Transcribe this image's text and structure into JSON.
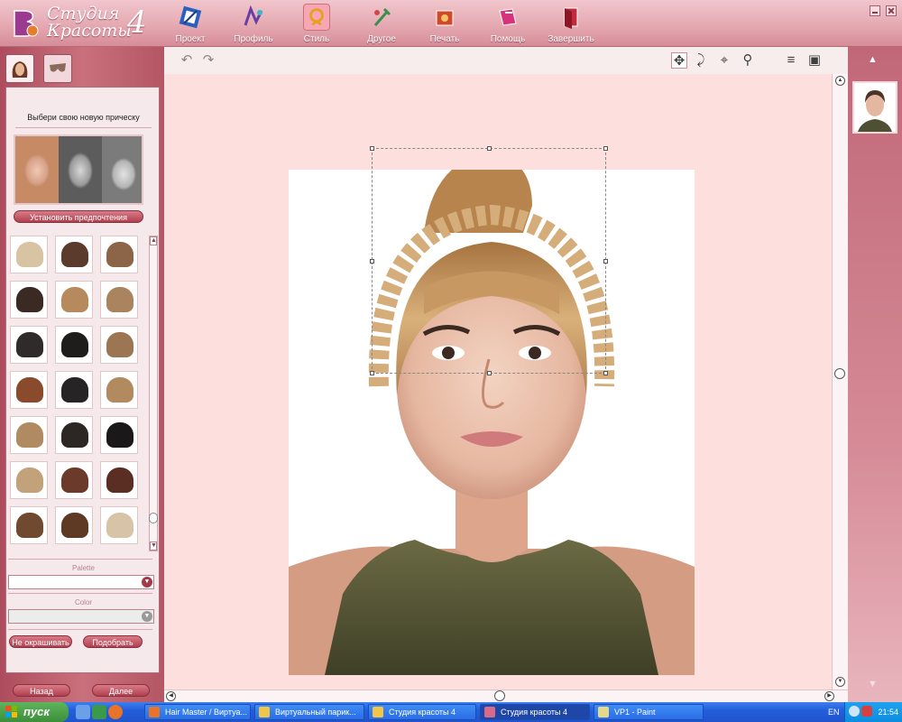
{
  "app": {
    "logo_line1": "Студия",
    "logo_line2": "Красоты",
    "logo_version": "4"
  },
  "toolbar": {
    "items": [
      {
        "label": "Проект",
        "icon": "project-icon"
      },
      {
        "label": "Профиль",
        "icon": "profile-icon"
      },
      {
        "label": "Стиль",
        "icon": "style-icon",
        "active": true
      },
      {
        "label": "Другое",
        "icon": "other-icon"
      },
      {
        "label": "Печать",
        "icon": "print-icon"
      },
      {
        "label": "Помощь",
        "icon": "help-icon"
      },
      {
        "label": "Завершить",
        "icon": "finish-icon"
      }
    ]
  },
  "left_panel": {
    "choose_title": "Выбери свою новую прическу",
    "prefs_button": "Установить предпочтения",
    "palette_label": "Palette",
    "color_label": "Color",
    "no_paint_button": "Не окрашивать",
    "pick_button": "Подобрать",
    "back_button": "Назад",
    "next_button": "Далее",
    "hair_colors": [
      "#d8c4a2",
      "#5a3b2c",
      "#8c6548",
      "#3b2a24",
      "#b68a5c",
      "#a9845e",
      "#2f2b2a",
      "#1f1d1c",
      "#9c7652",
      "#8a4a2c",
      "#262424",
      "#b28a60",
      "#b08a60",
      "#2c2624",
      "#1a1818",
      "#c2a27a",
      "#6b3a2a",
      "#5a2e22",
      "#6f4a30",
      "#5e3a24",
      "#d7c3a6"
    ]
  },
  "taskbar": {
    "start": "пуск",
    "tasks": [
      {
        "label": "Hair Master / Виртуа...",
        "icon_color": "#e8742a"
      },
      {
        "label": "Виртуальный парик...",
        "icon_color": "#f0c64a"
      },
      {
        "label": "Студия красоты 4",
        "icon_color": "#f0c64a"
      },
      {
        "label": "Студия красоты 4",
        "icon_color": "#d86a8a",
        "active": true
      },
      {
        "label": "VP1 - Paint",
        "icon_color": "#e8d88a"
      }
    ],
    "lang": "EN",
    "clock": "21:54"
  },
  "colors": {
    "accent": "#c9707d",
    "button": "#b0404f"
  }
}
